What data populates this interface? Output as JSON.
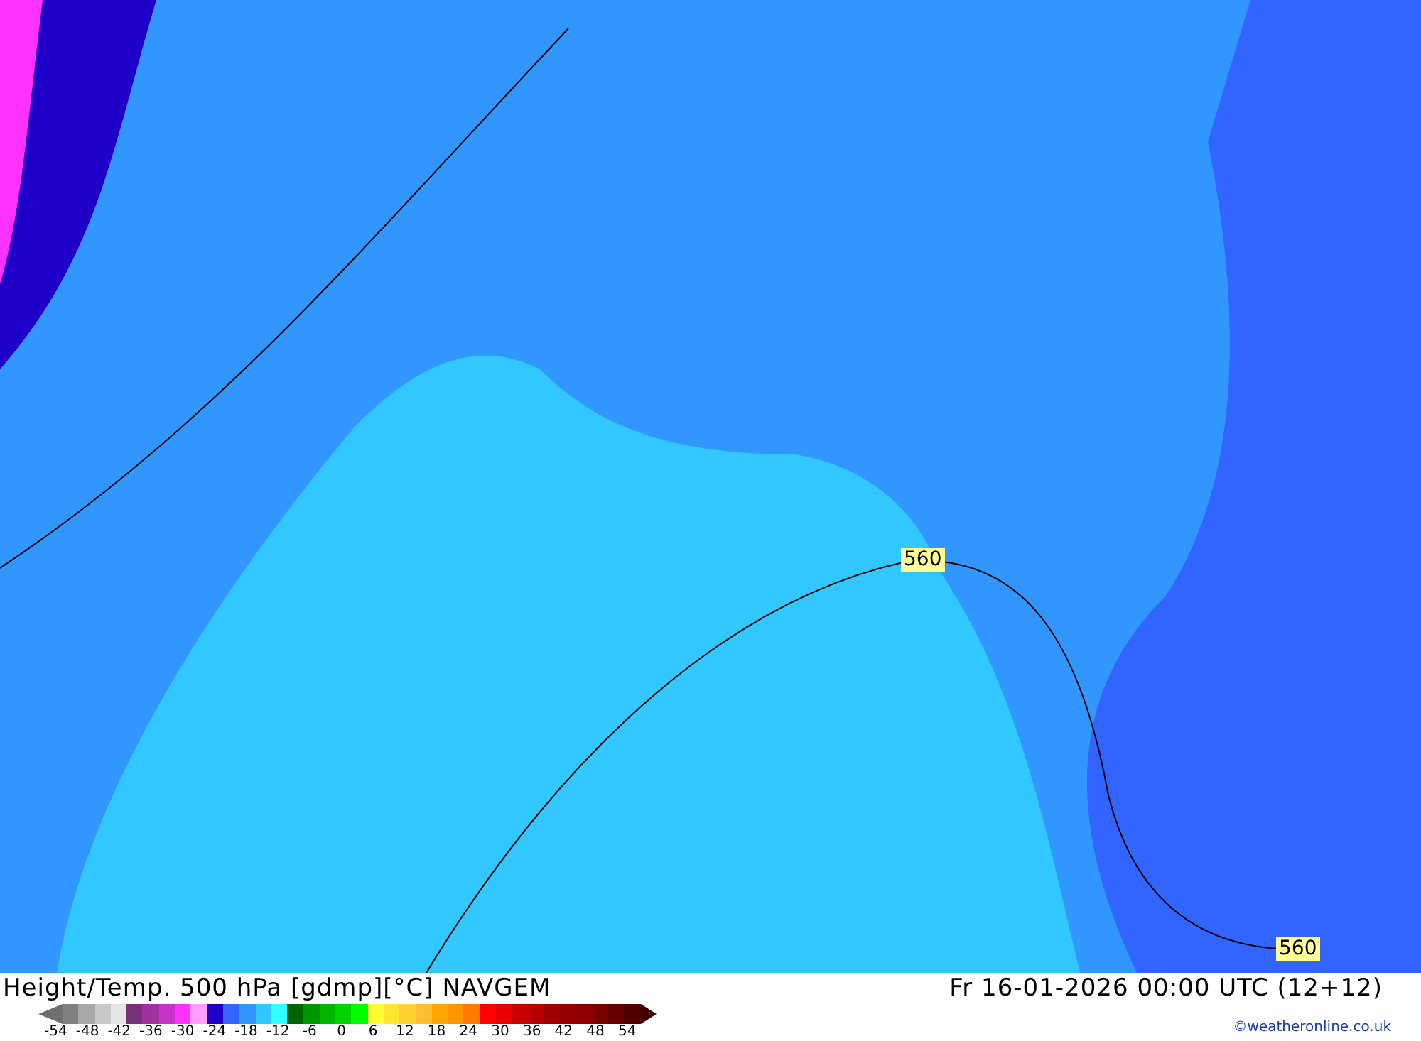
{
  "map": {
    "contour_labels": [
      {
        "text": "560"
      },
      {
        "text": "560"
      }
    ]
  },
  "footer": {
    "title": "Height/Temp. 500 hPa [gdmp][°C] NAVGEM",
    "datetime": "Fr 16-01-2026 00:00 UTC (12+12)",
    "credit": "©weatheronline.co.uk"
  },
  "legend": {
    "swatches": [
      {
        "color": "#808080"
      },
      {
        "color": "#a8a8a8"
      },
      {
        "color": "#c8c8c8"
      },
      {
        "color": "#e6e6e6"
      },
      {
        "color": "#783278"
      },
      {
        "color": "#a032a0"
      },
      {
        "color": "#c832c8"
      },
      {
        "color": "#ff32ff"
      },
      {
        "color": "#ffa0ff"
      },
      {
        "color": "#1e00c8"
      },
      {
        "color": "#3264ff"
      },
      {
        "color": "#3296ff"
      },
      {
        "color": "#32c8ff"
      },
      {
        "color": "#32ffff"
      },
      {
        "color": "#006400"
      },
      {
        "color": "#009600"
      },
      {
        "color": "#00b400"
      },
      {
        "color": "#00d200"
      },
      {
        "color": "#00ff00"
      },
      {
        "color": "#ffff32"
      },
      {
        "color": "#ffe632"
      },
      {
        "color": "#ffd232"
      },
      {
        "color": "#ffbe32"
      },
      {
        "color": "#ffa500"
      },
      {
        "color": "#ff9600"
      },
      {
        "color": "#ff7800"
      },
      {
        "color": "#ff0000"
      },
      {
        "color": "#e60000"
      },
      {
        "color": "#c80000"
      },
      {
        "color": "#b40000"
      },
      {
        "color": "#a00000"
      },
      {
        "color": "#960000"
      },
      {
        "color": "#8c0000"
      },
      {
        "color": "#780000"
      },
      {
        "color": "#640000"
      },
      {
        "color": "#500000"
      }
    ],
    "ticks": [
      "-54",
      "-48",
      "-42",
      "-36",
      "-30",
      "-24",
      "-18",
      "-12",
      "-6",
      "0",
      "6",
      "12",
      "18",
      "24",
      "30",
      "36",
      "42",
      "48",
      "54"
    ]
  }
}
